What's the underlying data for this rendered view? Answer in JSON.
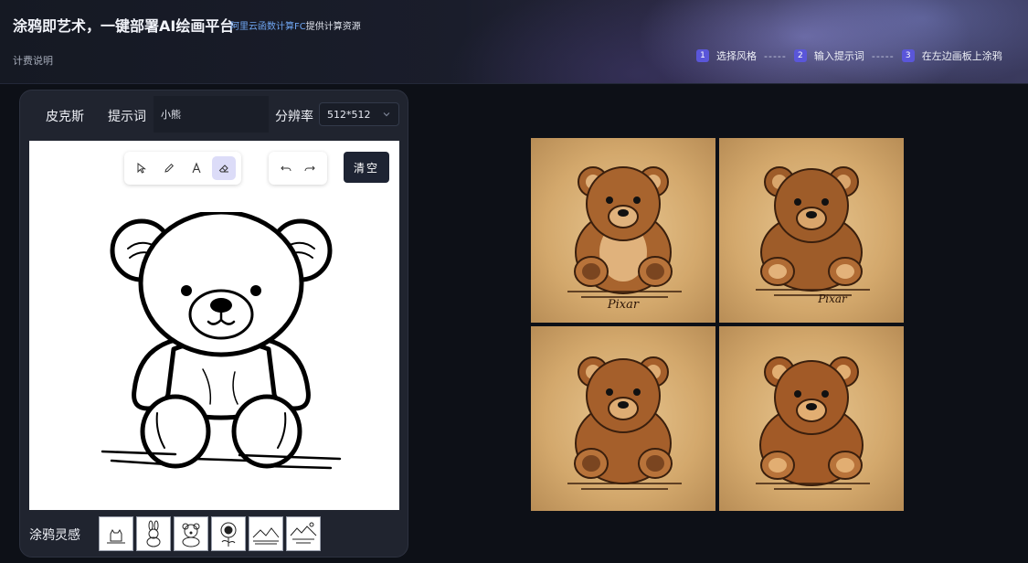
{
  "header": {
    "title": "涂鸦即艺术，一键部署AI绘画平台",
    "sub_link": "阿里云函数计算FC",
    "sub_text": "提供计算资源",
    "pricing": "计费说明"
  },
  "steps": [
    {
      "num": "1",
      "label": "选择风格"
    },
    {
      "num": "2",
      "label": "输入提示词"
    },
    {
      "num": "3",
      "label": "在左边画板上涂鸦"
    }
  ],
  "step_separator": "-----",
  "panel": {
    "model": "皮克斯",
    "prompt_label": "提示词",
    "prompt_value": "小熊",
    "resolution_label": "分辨率",
    "resolution_value": "512*512",
    "clear_label": "清空",
    "inspiration_label": "涂鸦灵感"
  },
  "tools": [
    {
      "name": "select-tool",
      "icon": "cursor-icon",
      "active": false
    },
    {
      "name": "pen-tool",
      "icon": "pencil-icon",
      "active": false
    },
    {
      "name": "text-tool",
      "icon": "text-icon",
      "active": false
    },
    {
      "name": "eraser-tool",
      "icon": "eraser-icon",
      "active": true
    }
  ],
  "history_tools": [
    {
      "name": "undo-button",
      "icon": "undo-icon"
    },
    {
      "name": "redo-button",
      "icon": "redo-icon"
    }
  ],
  "inspirations": [
    "cat-sketch",
    "rabbit-sketch",
    "bear-sketch",
    "sunflower-sketch",
    "landscape-sketch",
    "mountain-sketch"
  ],
  "colors": {
    "accent": "#5a56d9",
    "background": "#0d1017",
    "panel": "#20242f",
    "link": "#6fa6f2",
    "bear": "#a8642e",
    "paper": "#e7c58f"
  },
  "results": [
    {
      "label": "Pixar"
    },
    {
      "label": "Pixar"
    },
    {
      "label": ""
    },
    {
      "label": ""
    }
  ]
}
